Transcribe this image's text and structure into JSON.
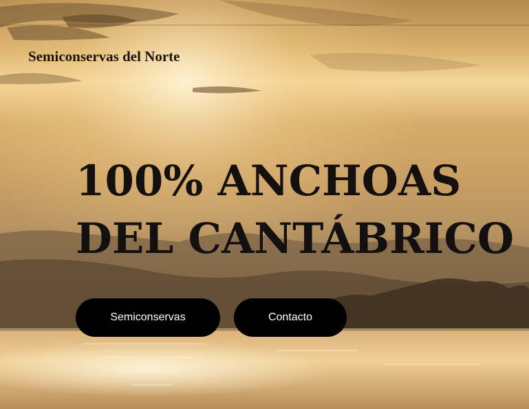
{
  "header": {
    "brand": "Semiconservas del Norte"
  },
  "hero": {
    "headline_line1": "100% ANCHOAS",
    "headline_line2": "DEL CANTÁBRICO"
  },
  "buttons": {
    "semiconservas_label": "Semiconservas",
    "contacto_label": "Contacto"
  },
  "colors": {
    "button_bg": "#000000",
    "button_text": "#ffffff",
    "headline": "#141010"
  }
}
